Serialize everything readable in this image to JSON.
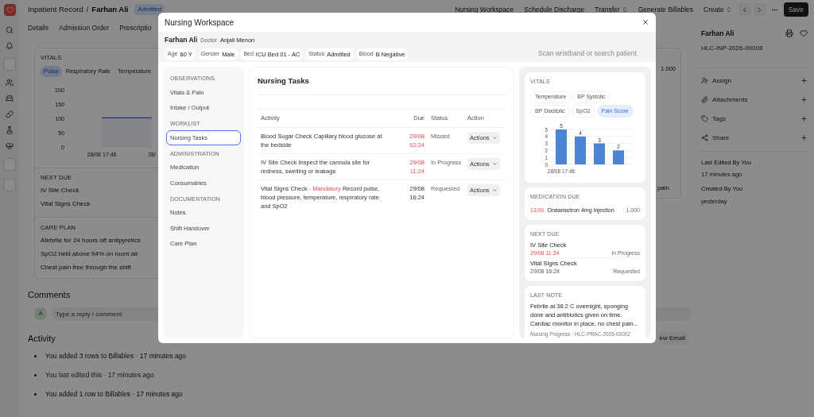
{
  "header": {
    "breadcrumb": [
      "Inpatient Record",
      "Farhan Ali"
    ],
    "separator": "/",
    "badge": "Admitted",
    "actions": [
      {
        "label": "Nursing Workspace",
        "kind": "plain"
      },
      {
        "label": "Schedule Discharge",
        "kind": "plain"
      },
      {
        "label": "Transfer",
        "kind": "dropdown"
      },
      {
        "label": "Generate Billables",
        "kind": "plain"
      },
      {
        "label": "Create",
        "kind": "dropdown"
      }
    ],
    "save": "Save"
  },
  "tabs": [
    "Details",
    "Admission Order",
    "Prescriptio"
  ],
  "vitals": {
    "title": "VITALS",
    "tabs": [
      {
        "label": "Pulse",
        "selected": true
      },
      {
        "label": "Respiratory Rate",
        "selected": false
      },
      {
        "label": "Temperature",
        "selected": false
      }
    ],
    "chart_data": {
      "type": "area",
      "x": [
        "28/08 17:46",
        "28/"
      ],
      "ylim": [
        0,
        200
      ],
      "yticks": [
        0,
        50,
        100,
        150,
        200
      ],
      "color": "#3b6fd6",
      "values": [
        102,
        102
      ]
    }
  },
  "next_due": {
    "title": "NEXT DUE",
    "items": [
      "IV Site Check",
      "Vital Signs Check"
    ]
  },
  "care_plan": {
    "title": "CARE PLAN",
    "items": [
      "Afebrile for 24 hours off antipyretics",
      "SpO2 held above 94% on room air",
      "Chest pain free through the shift"
    ]
  },
  "side_column": {
    "quantity": "1.000",
    "note_end": "pain"
  },
  "comments": {
    "title": "Comments",
    "avatar": "A",
    "placeholder": "Type a reply / comment"
  },
  "activity": {
    "title": "Activity",
    "email_button": "ew Email",
    "separator": "·",
    "items": [
      {
        "text": "You added 3 rows to Billables",
        "time": "17 minutes ago",
        "kind": "change"
      },
      {
        "text": "You last edited this",
        "time": "17 minutes ago",
        "kind": "edit"
      },
      {
        "text": "You added 1 row to Billables",
        "time": "17 minutes ago",
        "kind": "change"
      }
    ]
  },
  "sidebar": {
    "name": "Farhan Ali",
    "record_id": "HLC-INP-2026-00008",
    "actions": [
      "Assign",
      "Attachments",
      "Tags",
      "Share"
    ],
    "meta": [
      {
        "label": "Last Edited By You",
        "value": "17 minutes ago"
      },
      {
        "label": "Created By You",
        "value": "yesterday"
      }
    ]
  },
  "modal": {
    "title": "Nursing Workspace",
    "patient": {
      "name": "Farhan Ali",
      "doctor_label": "Doctor",
      "doctor": "Anjali Menon",
      "chips": [
        {
          "label": "Age",
          "value": "60 Y"
        },
        {
          "label": "Gender",
          "value": "Male"
        },
        {
          "label": "Bed",
          "value": "ICU Bed 01 - AC"
        },
        {
          "label": "Status",
          "value": "Admitted"
        },
        {
          "label": "Blood",
          "value": "B Negative"
        }
      ]
    },
    "search": {
      "placeholder": "Scan wristband or search patient"
    },
    "nav": [
      {
        "heading": "OBSERVATIONS",
        "items": [
          {
            "label": "Vitals & Pain",
            "selected": false
          },
          {
            "label": "Intake / Output",
            "selected": false
          }
        ]
      },
      {
        "heading": "WORKLIST",
        "items": [
          {
            "label": "Nursing Tasks",
            "selected": true
          }
        ]
      },
      {
        "heading": "ADMINISTRATION",
        "items": [
          {
            "label": "Medication",
            "selected": false
          },
          {
            "label": "Consumables",
            "selected": false
          }
        ]
      },
      {
        "heading": "DOCUMENTATION",
        "items": [
          {
            "label": "Notes",
            "selected": false
          },
          {
            "label": "Shift Handover",
            "selected": false
          },
          {
            "label": "Care Plan",
            "selected": false
          }
        ]
      }
    ],
    "tasks": {
      "title": "Nursing Tasks",
      "columns": [
        "Activity",
        "Due",
        "Status",
        "Action"
      ],
      "rows": [
        {
          "name": "Blood Sugar Check",
          "detail": "Capillary blood glucose at the bedside",
          "due": "29/08 02:24",
          "overdue": true,
          "status": "Missed",
          "action": "Actions"
        },
        {
          "name": "IV Site Check",
          "detail": "Inspect the cannula site for redness, swelling or leakage",
          "due": "29/08 11:24",
          "overdue": true,
          "status": "In Progress",
          "action": "Actions"
        },
        {
          "name": "Vital Signs Check",
          "flag": "- Mandatory",
          "detail": "Record pulse, blood pressure, temperature, respiratory rate and SpO2",
          "due": "29/08 16:24",
          "overdue": false,
          "status": "Requested",
          "action": "Actions"
        }
      ]
    },
    "vitals": {
      "title": "VITALS",
      "chips": [
        {
          "label": "Temperature",
          "selected": false
        },
        {
          "label": "BP Systolic",
          "selected": false
        },
        {
          "label": "BP Diastolic",
          "selected": false
        },
        {
          "label": "SpO2",
          "selected": false
        },
        {
          "label": "Pain Score",
          "selected": true
        }
      ],
      "chart_data": {
        "type": "bar",
        "categories": [
          "28/08 17:46",
          null,
          null,
          null
        ],
        "values": [
          5,
          4,
          3,
          2
        ],
        "ylim": [
          0,
          5
        ],
        "yticks": [
          0,
          1,
          2,
          3,
          4,
          5
        ],
        "grid": true,
        "data_labels": true,
        "color": "#4a84d4"
      }
    },
    "medication_due": {
      "title": "MEDICATION DUE",
      "items": [
        {
          "time": "13:00",
          "name": "Ondansetron 4mg Injection",
          "quantity": "1.000"
        }
      ]
    },
    "next_due": {
      "title": "NEXT DUE",
      "items": [
        {
          "name": "IV Site Check",
          "due": "29/08 11:24",
          "overdue": true,
          "status": "In Progress"
        },
        {
          "name": "Vital Signs Check",
          "due": "29/08 16:24",
          "overdue": false,
          "status": "Requested"
        }
      ]
    },
    "last_note": {
      "title": "LAST NOTE",
      "text": "Febrile at 38.2 C overnight, sponging done and antibiotics given on time. Cardiac monitor in place, no chest pain...",
      "source": "Nursing Progress · HLC-PRAC-2026-00002"
    }
  }
}
